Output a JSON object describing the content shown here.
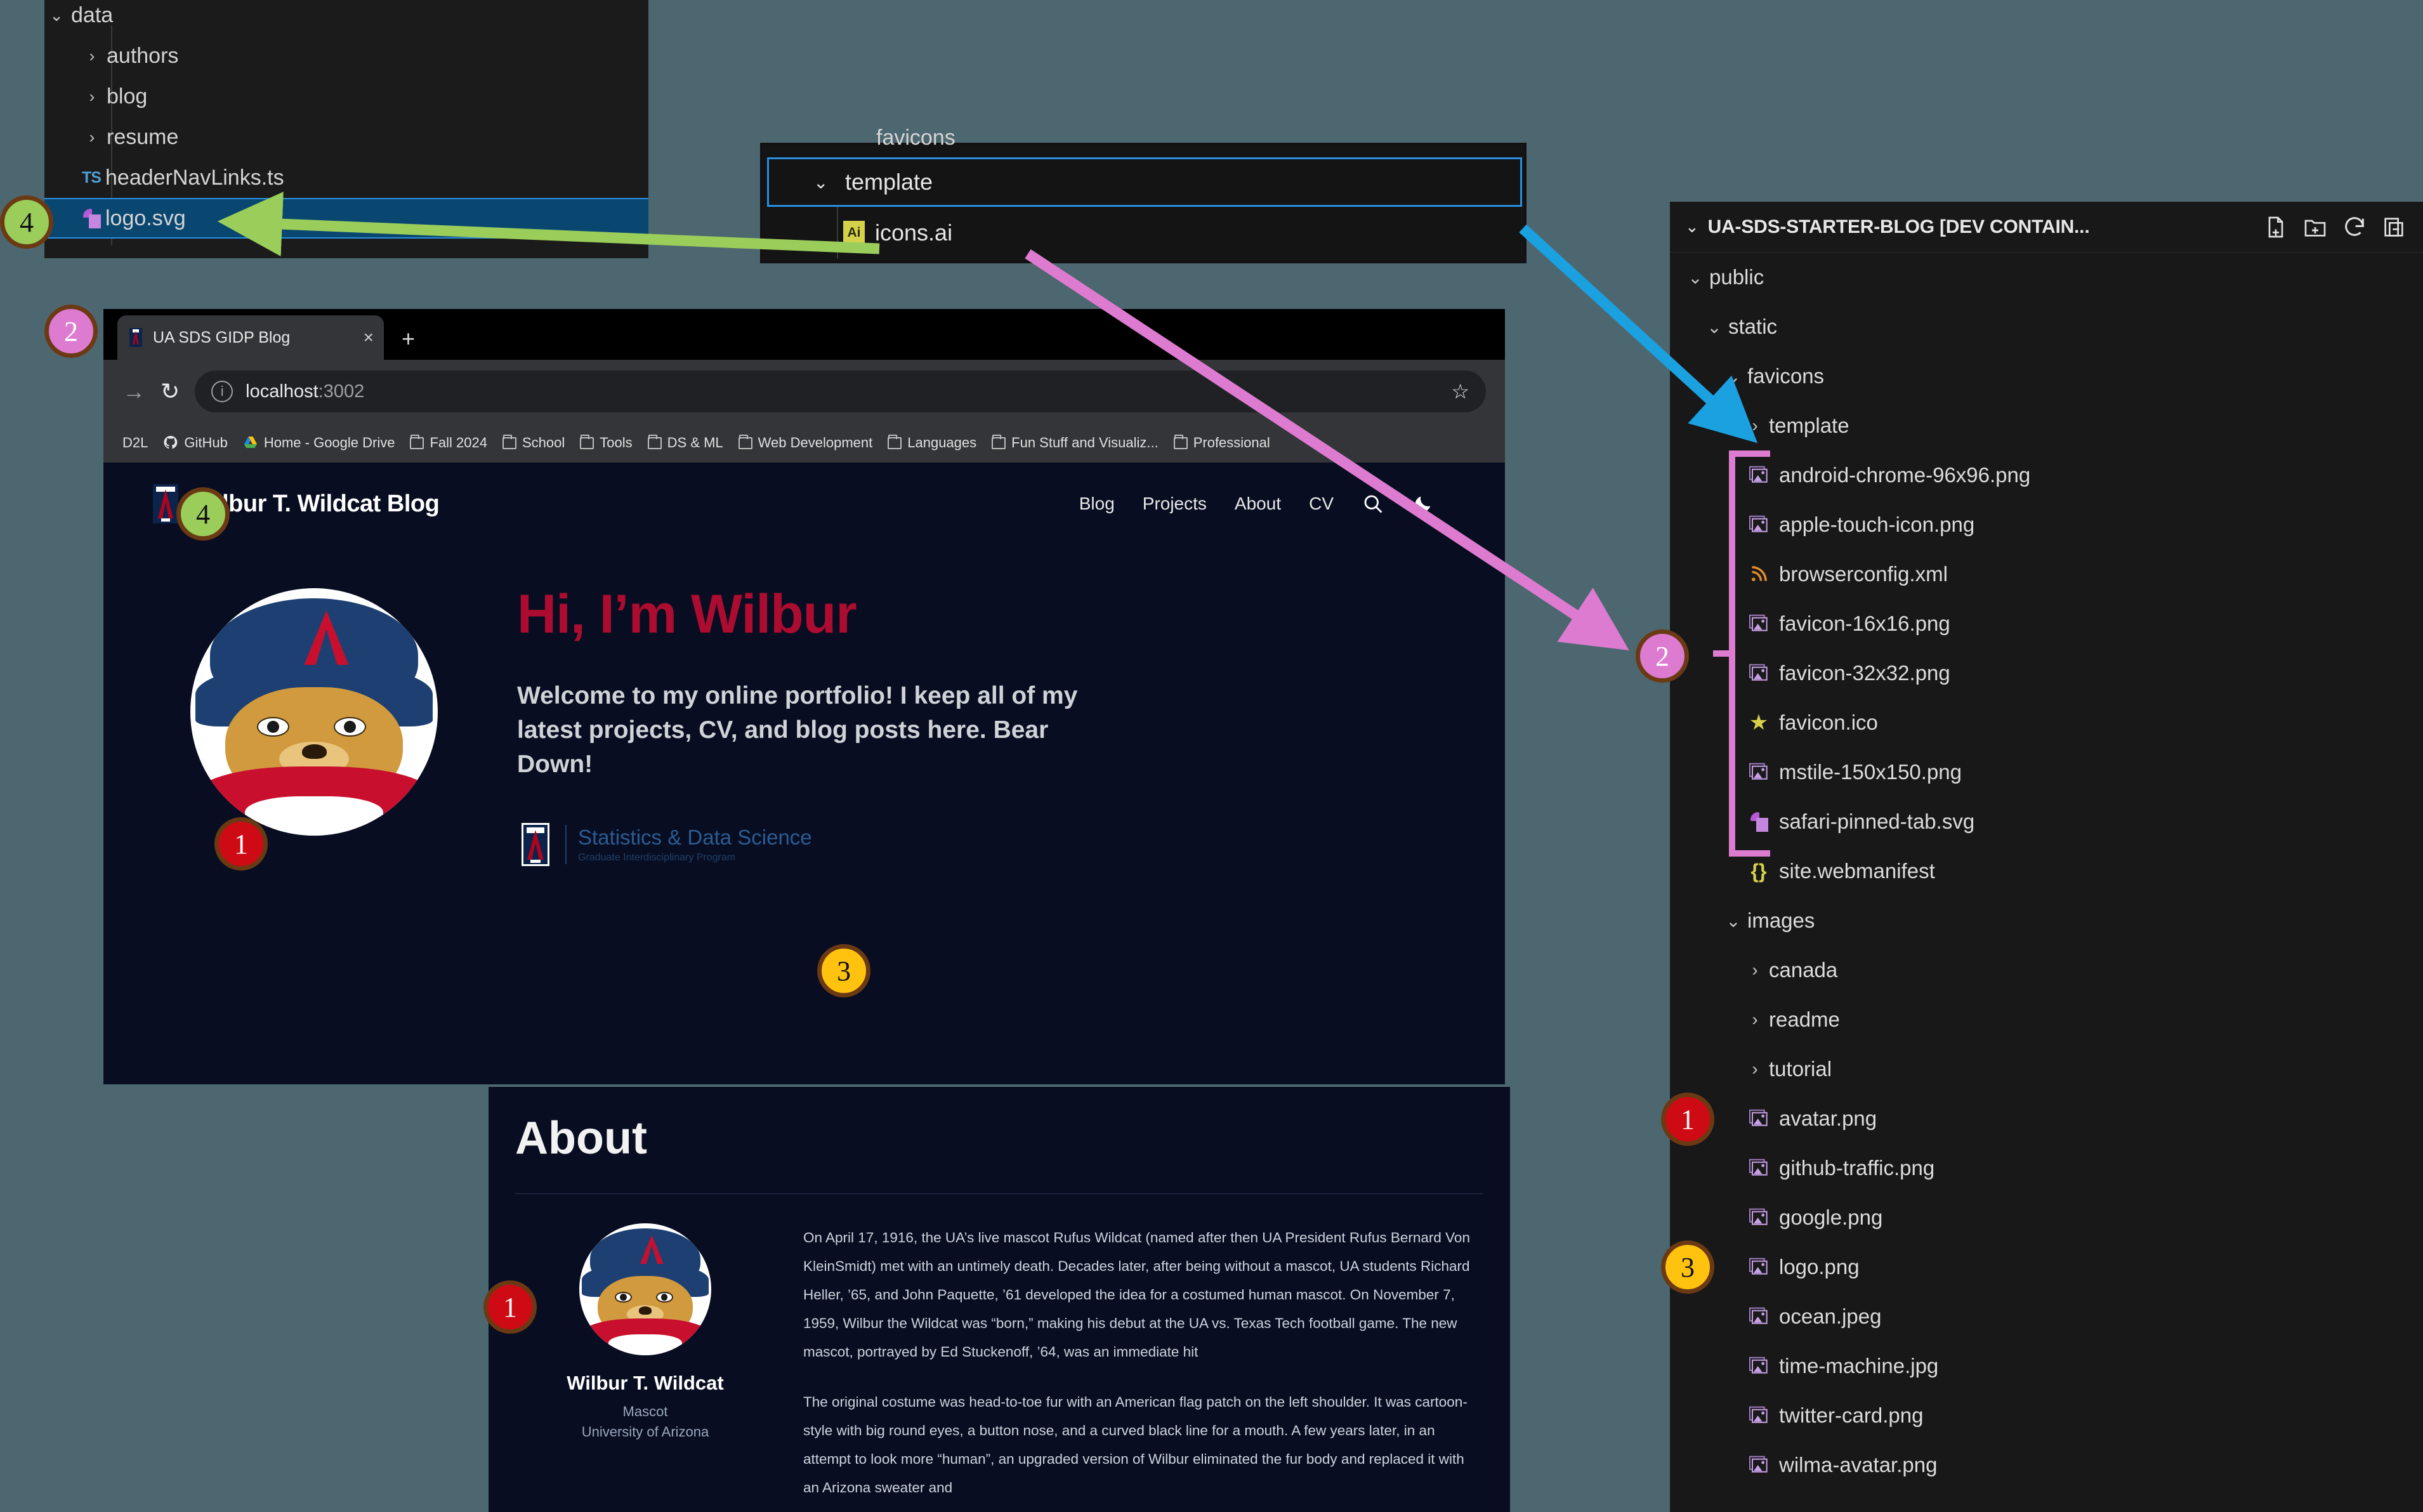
{
  "colors": {
    "canvas": "#4d6770",
    "vscode_bg": "#1b1b1b",
    "selection_blue": "#094771",
    "accent_blue": "#2a8fe0",
    "arrow_green": "#9acd5a",
    "arrow_pink": "#dd7bd0",
    "arrow_cyan": "#1ba0e0",
    "badge_red": "#ce0a14",
    "badge_yellow": "#ffc20e",
    "badge_green": "#9acd5a",
    "badge_pink": "#dd7bd0",
    "ua_red": "#ab0c2f",
    "page_bg": "#080d21"
  },
  "vscode_left": {
    "rows": [
      {
        "label": "data",
        "icon": "chevron-down-icon",
        "kind": "folder",
        "indent": 0,
        "selected": false
      },
      {
        "label": "authors",
        "icon": "chevron-right-icon",
        "kind": "folder",
        "indent": 1,
        "selected": false
      },
      {
        "label": "blog",
        "icon": "chevron-right-icon",
        "kind": "folder",
        "indent": 1,
        "selected": false
      },
      {
        "label": "resume",
        "icon": "chevron-right-icon",
        "kind": "folder",
        "indent": 1,
        "selected": false
      },
      {
        "label": "headerNavLinks.ts",
        "icon": "typescript-icon",
        "kind": "file",
        "indent": 1,
        "selected": false
      },
      {
        "label": "logo.svg",
        "icon": "svg-file-icon",
        "kind": "file",
        "indent": 1,
        "selected": true
      }
    ]
  },
  "vscode_mid": {
    "cut_off_label": "favicons",
    "template_label": "template",
    "template_chevron": "chevron-down-icon",
    "icons_file_label": "icons.ai",
    "icons_file_badge": "Ai"
  },
  "vscode_right": {
    "header": {
      "title": "UA-SDS-STARTER-BLOG [DEV CONTAIN...",
      "chevron": "chevron-down-icon",
      "actions": [
        "new-file-icon",
        "new-folder-icon",
        "refresh-icon",
        "collapse-all-icon"
      ]
    },
    "rows": [
      {
        "label": "public",
        "icon": "chevron-down-icon",
        "kind": "folder",
        "depth": 1
      },
      {
        "label": "static",
        "icon": "chevron-down-icon",
        "kind": "folder",
        "depth": 2
      },
      {
        "label": "favicons",
        "icon": "chevron-down-icon",
        "kind": "folder",
        "depth": 3
      },
      {
        "label": "template",
        "icon": "chevron-right-icon",
        "kind": "folder",
        "depth": 4
      },
      {
        "label": "android-chrome-96x96.png",
        "icon": "image-file-icon",
        "kind": "file",
        "depth": 4
      },
      {
        "label": "apple-touch-icon.png",
        "icon": "image-file-icon",
        "kind": "file",
        "depth": 4
      },
      {
        "label": "browserconfig.xml",
        "icon": "rss-file-icon",
        "kind": "file",
        "depth": 4
      },
      {
        "label": "favicon-16x16.png",
        "icon": "image-file-icon",
        "kind": "file",
        "depth": 4
      },
      {
        "label": "favicon-32x32.png",
        "icon": "image-file-icon",
        "kind": "file",
        "depth": 4
      },
      {
        "label": "favicon.ico",
        "icon": "star-file-icon",
        "kind": "file",
        "depth": 4
      },
      {
        "label": "mstile-150x150.png",
        "icon": "image-file-icon",
        "kind": "file",
        "depth": 4
      },
      {
        "label": "safari-pinned-tab.svg",
        "icon": "svg-file-icon",
        "kind": "file",
        "depth": 4
      },
      {
        "label": "site.webmanifest",
        "icon": "json-file-icon",
        "kind": "file",
        "depth": 4
      },
      {
        "label": "images",
        "icon": "chevron-down-icon",
        "kind": "folder",
        "depth": 3
      },
      {
        "label": "canada",
        "icon": "chevron-right-icon",
        "kind": "folder",
        "depth": 4
      },
      {
        "label": "readme",
        "icon": "chevron-right-icon",
        "kind": "folder",
        "depth": 4
      },
      {
        "label": "tutorial",
        "icon": "chevron-right-icon",
        "kind": "folder",
        "depth": 4
      },
      {
        "label": "avatar.png",
        "icon": "image-file-icon",
        "kind": "file",
        "depth": 4
      },
      {
        "label": "github-traffic.png",
        "icon": "image-file-icon",
        "kind": "file",
        "depth": 4
      },
      {
        "label": "google.png",
        "icon": "image-file-icon",
        "kind": "file",
        "depth": 4
      },
      {
        "label": "logo.png",
        "icon": "image-file-icon",
        "kind": "file",
        "depth": 4
      },
      {
        "label": "ocean.jpeg",
        "icon": "image-file-icon",
        "kind": "file",
        "depth": 4
      },
      {
        "label": "time-machine.jpg",
        "icon": "image-file-icon",
        "kind": "file",
        "depth": 4
      },
      {
        "label": "twitter-card.png",
        "icon": "image-file-icon",
        "kind": "file",
        "depth": 4
      },
      {
        "label": "wilma-avatar.png",
        "icon": "image-file-icon",
        "kind": "file",
        "depth": 4
      }
    ]
  },
  "browser": {
    "tab": {
      "title": "UA SDS GIDP Blog",
      "close": "×",
      "favicon": "ua-logo-icon"
    },
    "new_tab_label": "+",
    "forward_icon": "→",
    "reload_icon": "↻",
    "url_host": "localhost",
    "url_port": ":3002",
    "star_icon": "☆",
    "bookmarks": [
      {
        "label": "D2L",
        "icon": "d2l-icon"
      },
      {
        "label": "GitHub",
        "icon": "github-icon"
      },
      {
        "label": "Home - Google Drive",
        "icon": "google-drive-icon"
      },
      {
        "label": "Fall 2024",
        "icon": "folder-icon"
      },
      {
        "label": "School",
        "icon": "folder-icon"
      },
      {
        "label": "Tools",
        "icon": "folder-icon"
      },
      {
        "label": "DS & ML",
        "icon": "folder-icon"
      },
      {
        "label": "Web Development",
        "icon": "folder-icon"
      },
      {
        "label": "Languages",
        "icon": "folder-icon"
      },
      {
        "label": "Fun Stuff and Visualiz...",
        "icon": "folder-icon"
      },
      {
        "label": "Professional",
        "icon": "folder-icon"
      }
    ]
  },
  "blog": {
    "brand_title": "Wilbur T. Wildcat Blog",
    "nav": [
      "Blog",
      "Projects",
      "About",
      "CV"
    ],
    "search_icon": "search-icon",
    "theme_icon": "moon-icon",
    "hero_heading": "Hi, I’m Wilbur",
    "hero_paragraph": "Welcome to my online portfolio! I keep all of my latest projects, CV, and blog posts here. Bear Down!",
    "sds_line1": "Statistics & Data Science",
    "sds_line2": "Graduate Interdisciplinary Program"
  },
  "about": {
    "heading": "About",
    "person_name": "Wilbur T. Wildcat",
    "person_role": "Mascot",
    "person_org": "University of Arizona",
    "paragraph1": "On April 17, 1916, the UA’s live mascot Rufus Wildcat (named after then UA President Rufus Bernard Von KleinSmidt) met with an untimely death. Decades later, after being without a mascot, UA students Richard Heller, ’65, and John Paquette, ’61 developed the idea for a costumed human mascot. On November 7, 1959, Wilbur the Wildcat was “born,” making his debut at the UA vs. Texas Tech football game. The new mascot, portrayed by Ed Stuckenoff, ’64, was an immediate hit",
    "paragraph2": "The original costume was head-to-toe fur with an American flag patch on the left shoulder. It was cartoon-style with big round eyes, a button nose, and a curved black line for a mouth. A few years later, in an attempt to look more “human”, an upgraded version of Wilbur eliminated the fur body and replaced it with an Arizona sweater and"
  },
  "annotations": {
    "badges": [
      {
        "number": "4",
        "color": "green",
        "target": "logo.svg tree row"
      },
      {
        "number": "2",
        "color": "pink",
        "target": "browser window"
      },
      {
        "number": "4",
        "color": "green",
        "target": "blog header logo"
      },
      {
        "number": "1",
        "color": "red",
        "target": "hero mascot image"
      },
      {
        "number": "3",
        "color": "yellow",
        "target": "sds logo"
      },
      {
        "number": "1",
        "color": "red",
        "target": "about mascot image"
      },
      {
        "number": "2",
        "color": "pink",
        "target": "favicons group"
      },
      {
        "number": "1",
        "color": "red",
        "target": "avatar.png"
      },
      {
        "number": "3",
        "color": "yellow",
        "target": "logo.png"
      }
    ],
    "arrows": [
      {
        "color": "green",
        "from": "icons.ai",
        "to": "logo.svg"
      },
      {
        "color": "pink",
        "from": "icons.ai",
        "to": "favicons group"
      },
      {
        "color": "cyan",
        "from": "template popout",
        "to": "template folder"
      }
    ]
  }
}
